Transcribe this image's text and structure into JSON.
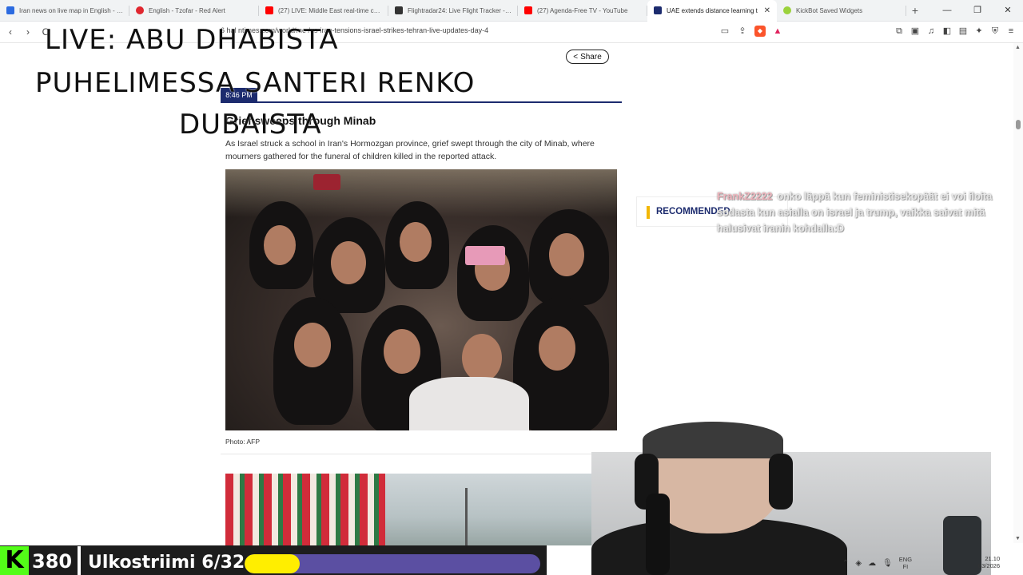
{
  "tabs": [
    {
      "title": "Iran news on live map in English - Ca",
      "color": "#2c6be0"
    },
    {
      "title": "English - Tzofar - Red Alert",
      "color": "#e0272f"
    },
    {
      "title": "(27) LIVE: Middle East real-time cam",
      "color": "#ff0000"
    },
    {
      "title": "Flightradar24: Live Flight Tracker - Re",
      "color": "#333333"
    },
    {
      "title": "(27) Agenda-Free TV - YouTube",
      "color": "#ff0000"
    },
    {
      "title": "UAE extends distance learning t",
      "color": "#1c2b6e",
      "active": true
    },
    {
      "title": "KickBot Saved Widgets",
      "color": "#9bd23c"
    }
  ],
  "address": {
    "url": "6   hal ntimes.com/world/me  /us-iran-tensions-israel-strikes-tehran-live-updates-day-4"
  },
  "article": {
    "share_label": "Share",
    "time": "8:46 PM",
    "headline": "Grief sweeps through Minab",
    "body": "As Israel struck a school in Iran's Hormozgan province, grief swept through the city of Minab, where mourners gathered for the funeral of children killed in the reported attack.",
    "photo_caption": "Photo: AFP"
  },
  "sidebar": {
    "recommended_label": "RECOMMENDED"
  },
  "overlay": {
    "live_line1": "LIVE: ABU DHABISTA",
    "live_line2": "PUHELIMESSA SANTERI RENKO",
    "live_line3": "DUBAISTA"
  },
  "chat": {
    "username": "FrankZ2222",
    "message": "onko läppä kun feministisekopäät ei voi iloita sodasta kun asialla on israel ja trump, vaikka saivat mitä halusivat iranin kohdalla:D"
  },
  "stream_bar": {
    "logo": "K",
    "viewers": "380",
    "goal_label": "Ulkostriimi 6/32",
    "goal_progress": 0.1875,
    "accent_color": "#53fc18",
    "goal_fill_color": "#ffee00",
    "goal_track_color": "#5b4fa2"
  },
  "taskbar": {
    "lang_top": "ENG",
    "lang_bottom": "FI",
    "time": "21.10",
    "date": "03/2026"
  }
}
